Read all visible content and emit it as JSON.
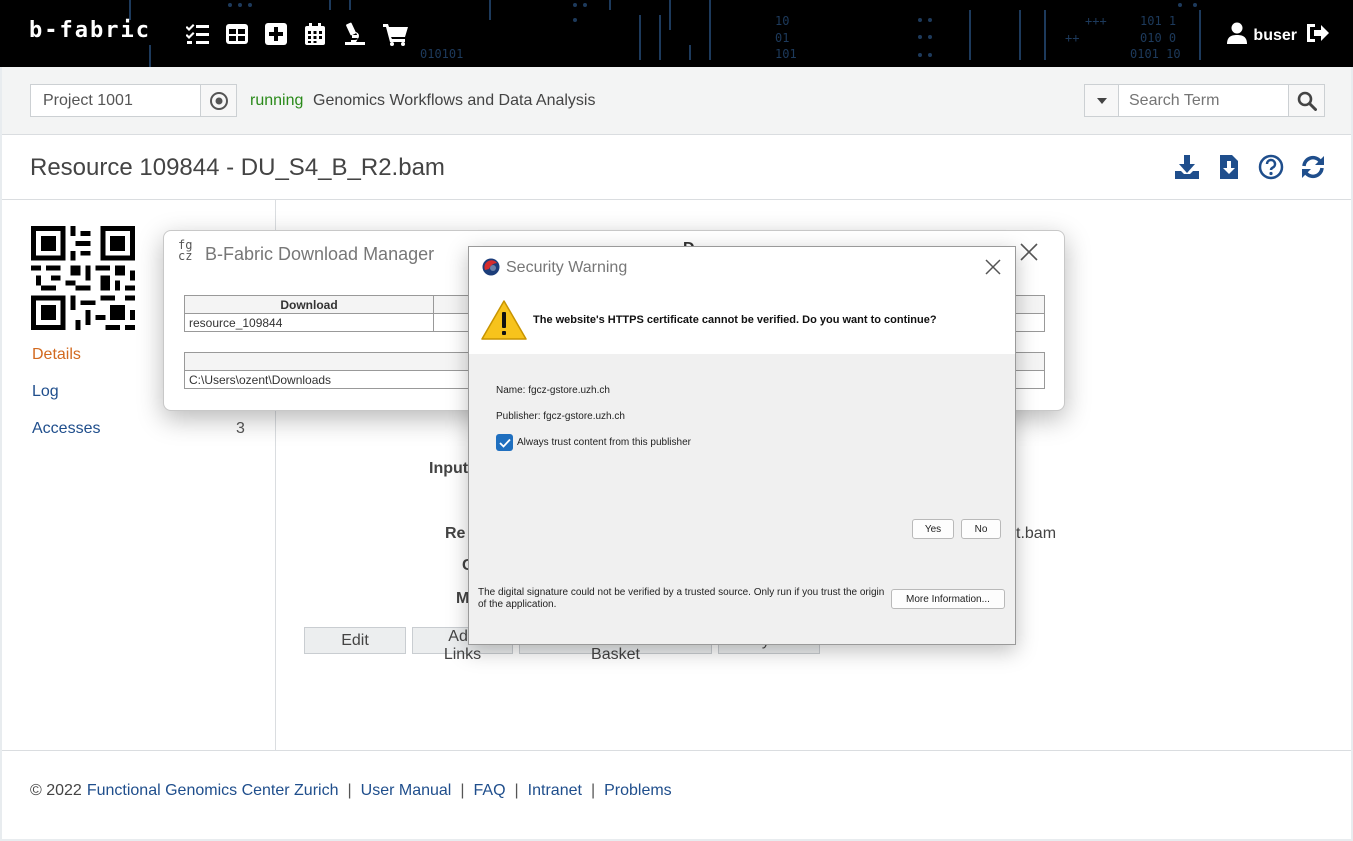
{
  "topbar": {
    "brand": "b-fabric",
    "icons": [
      "tasks-icon",
      "table-icon",
      "plus-square-icon",
      "calendar-icon",
      "microscope-icon",
      "cart-icon"
    ],
    "username": "buser"
  },
  "projectbar": {
    "project": "Project 1001",
    "status": "running",
    "status_color": "#2a8a1a",
    "project_name": "Genomics Workflows and Data Analysis",
    "search_placeholder": "Search Term"
  },
  "title": {
    "text": "Resource 109844 - DU_S4_B_R2.bam"
  },
  "sidebar": {
    "details": "Details",
    "log": "Log",
    "accesses": "Accesses",
    "accesses_count": "3"
  },
  "main": {
    "label_input": "Input",
    "label_re": "Re",
    "label_c": "C",
    "label_m": "M",
    "partial_value": "t.bam",
    "buttons": [
      "Edit",
      "Add Links",
      "Add to Resource Basket",
      "Sync"
    ]
  },
  "download_manager": {
    "logo": "fg\ncz",
    "title": "B-Fabric Download Manager",
    "behind_text": "D",
    "col_download": "Download",
    "resource": "resource_109844",
    "path": "C:\\Users\\ozent\\Downloads"
  },
  "security_warning": {
    "title": "Security Warning",
    "message": "The website's HTTPS certificate cannot be verified. Do you want to continue?",
    "name_line": "Name:   fgcz-gstore.uzh.ch",
    "publisher_line": "Publisher: fgcz-gstore.uzh.ch",
    "checkbox_label": "Always trust content from this publisher",
    "yes": "Yes",
    "no": "No",
    "footer": "The digital signature could not be verified by a trusted source. Only run if you trust the origin of the application.",
    "more_info": "More Information..."
  },
  "footer": {
    "copyright": "© 2022",
    "center": "Functional Genomics Center Zurich",
    "manual": "User Manual",
    "faq": "FAQ",
    "intranet": "Intranet",
    "problems": "Problems",
    "sep": "|"
  },
  "colors": {
    "link": "#1f4e8c",
    "active_link": "#d2691e",
    "topbar_bg": "#000000",
    "checkbox_blue": "#1f6fbf"
  }
}
